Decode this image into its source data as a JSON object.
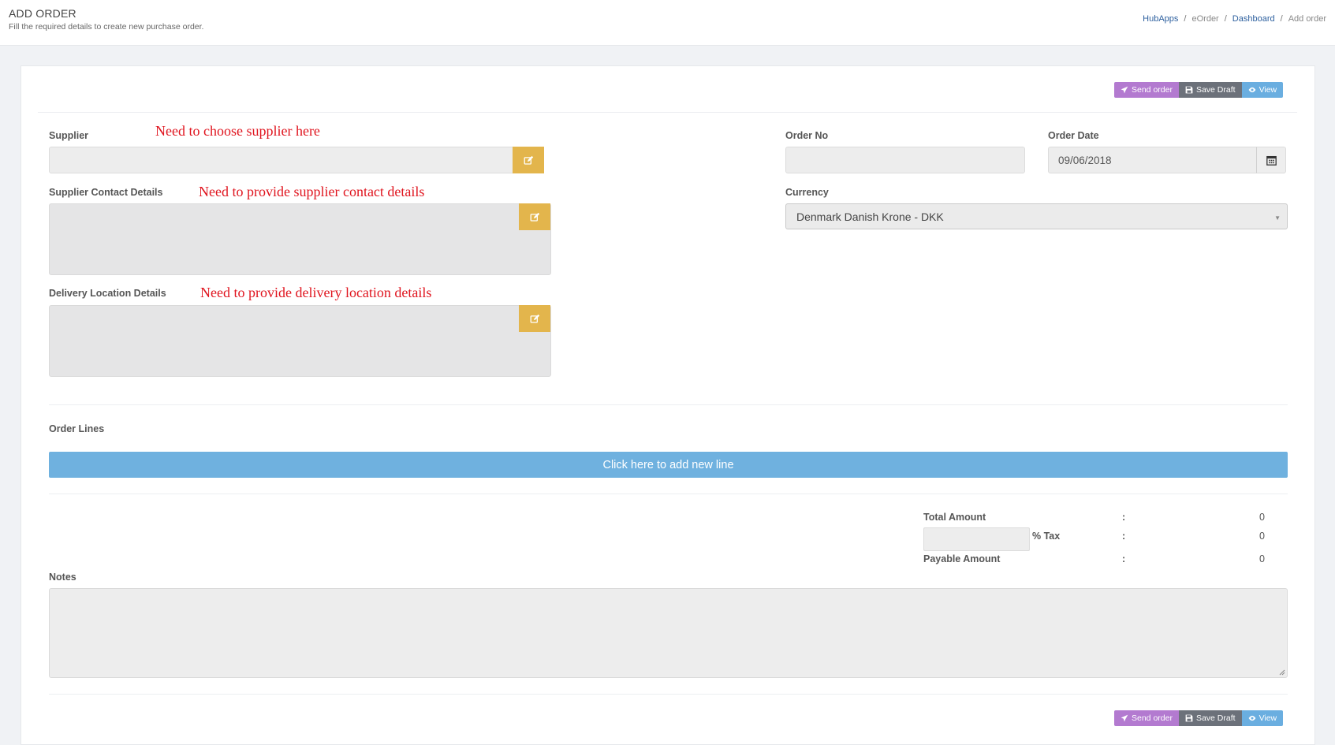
{
  "header": {
    "title": "ADD ORDER",
    "subtitle": "Fill the required details to create new purchase order.",
    "breadcrumb": [
      "HubApps",
      "eOrder",
      "Dashboard",
      "Add order"
    ]
  },
  "toolbar": {
    "send_label": "Send order",
    "draft_label": "Save Draft",
    "view_label": "View"
  },
  "form": {
    "supplier": {
      "label": "Supplier",
      "annotation": "Need to choose supplier here",
      "value": ""
    },
    "supplier_contact": {
      "label": "Supplier Contact Details",
      "annotation": "Need to provide supplier contact details"
    },
    "delivery_location": {
      "label": "Delivery Location Details",
      "annotation": "Need to provide delivery location details"
    },
    "order_no": {
      "label": "Order No",
      "value": ""
    },
    "order_date": {
      "label": "Order Date",
      "value": "09/06/2018"
    },
    "currency": {
      "label": "Currency",
      "value": "Denmark Danish Krone - DKK"
    }
  },
  "order_lines": {
    "label": "Order Lines",
    "add_line_label": "Click here to add new line"
  },
  "totals": {
    "total_amount_label": "Total Amount",
    "total_amount_value": "0",
    "tax_label": "% Tax",
    "tax_value": "0",
    "payable_amount_label": "Payable Amount",
    "payable_amount_value": "0",
    "colon": ":"
  },
  "notes": {
    "label": "Notes"
  },
  "colors": {
    "send": "#b37ad0",
    "draft": "#6c717a",
    "view": "#6aaee0",
    "edit": "#e3b54c",
    "add_line": "#6fb1df",
    "annotation": "#e0141e"
  }
}
